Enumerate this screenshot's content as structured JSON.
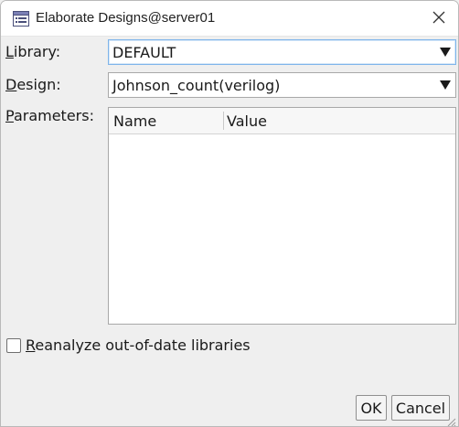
{
  "window": {
    "title": "Elaborate Designs@server01",
    "close_glyph": "✕"
  },
  "form": {
    "library": {
      "label_mnemonic": "L",
      "label_rest": "ibrary:",
      "value": "DEFAULT"
    },
    "design": {
      "label_mnemonic": "D",
      "label_rest": "esign:",
      "value": "Johnson_count(verilog)"
    },
    "parameters": {
      "label_mnemonic": "P",
      "label_rest": "arameters:"
    },
    "dropdown_glyph": "▼"
  },
  "parameters_table": {
    "columns": [
      "Name",
      "Value"
    ],
    "rows": []
  },
  "reanalyze": {
    "label_mnemonic": "R",
    "label_rest": "eanalyze out-of-date libraries",
    "checked": false
  },
  "buttons": {
    "ok": "OK",
    "cancel": "Cancel"
  },
  "icons": {
    "app": "dialog-list-icon",
    "close": "close-icon",
    "dropdown": "dropdown-arrow-icon",
    "resize": "resize-grip-icon"
  },
  "colors": {
    "focus_border": "#7eb4ea",
    "window_bg": "#efefef",
    "field_bg": "#ffffff"
  }
}
